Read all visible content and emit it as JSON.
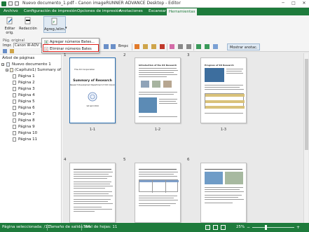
{
  "window": {
    "title": "Nuevo documento_1.pdf - Canon imageRUNNER ADVANCE Desktop - Editor",
    "controls": [
      "minimize",
      "maximize",
      "close"
    ]
  },
  "menu": {
    "tabs": [
      {
        "label": "Archivo"
      },
      {
        "label": "Configuración de impresión"
      },
      {
        "label": "Opciones de impresión"
      },
      {
        "label": "Anotaciones"
      },
      {
        "label": "Escanear"
      },
      {
        "label": "Herramientas"
      }
    ],
    "active": "Herramientas"
  },
  "ribbon": {
    "edit_label": "Editar\norig.",
    "edit_label_1": "Editar",
    "edit_label_2": "orig.",
    "redaction_label": "Redacción",
    "group_label": "Pág. original",
    "add_label": "Agreg./elim.",
    "printer_prefix": "Impr.",
    "printer_value": "Canon iR-ADV",
    "color_value": "Bmpc",
    "show_annotations": "Mostrar anotac."
  },
  "dropdown": {
    "items": [
      {
        "label": "Agregar números Bates..."
      },
      {
        "label": "Eliminar números Bates"
      }
    ]
  },
  "tree": {
    "header": "Árbol de páginas",
    "root": "Nuevo documento 1",
    "chapter": "(Capítulo1) Summary of R",
    "pages": [
      "Página 1",
      "Página 2",
      "Página 3",
      "Página 4",
      "Página 5",
      "Página 6",
      "Página 7",
      "Página 8",
      "Página 9",
      "Página 10",
      "Página 11"
    ]
  },
  "viewer": {
    "page_numbers": [
      "1",
      "2",
      "3",
      "4",
      "5",
      "6"
    ],
    "page_labels": [
      "1-1",
      "1-2",
      "1-3"
    ],
    "page1": {
      "company": "The XX Corporation",
      "title": "Summary of Research",
      "subtitle": "Research Development Department of XXX Corporation",
      "date": "1st April 2014"
    },
    "page2": {
      "heading": "Introduction of the XX Research"
    },
    "page3": {
      "heading": "Progress of XX Research"
    }
  },
  "status": {
    "selected_pages": "Página seleccionada: /11",
    "output_size": "Tamaño de salida: A4",
    "total_pages": "Total de hojas: 11",
    "zoom": "25%"
  },
  "colors": {
    "accent": "#1e7b3c",
    "highlight": "#e0221c",
    "selection": "#2a6fb0"
  }
}
